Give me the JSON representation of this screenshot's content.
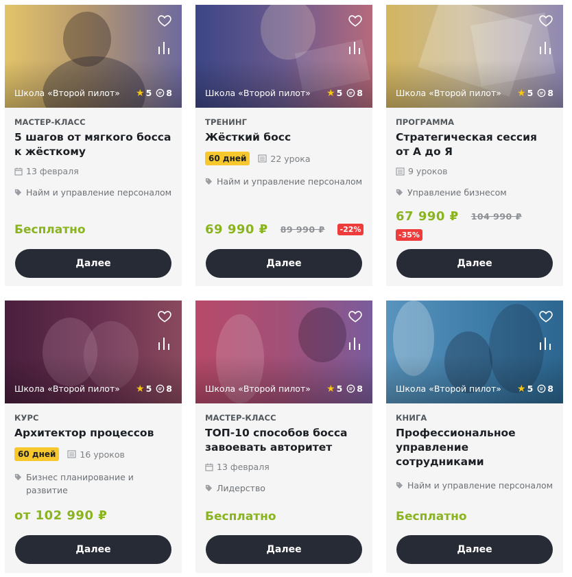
{
  "cards": [
    {
      "school": "Школа «Второй пилот»",
      "rating": "5",
      "comments": "8",
      "type": "МАСТЕР-КЛАСС",
      "title": "5 шагов от мягкого босса к жёсткому",
      "date": "13 февраля",
      "tag": "Найм и управление персоналом",
      "price_free": "Бесплатно",
      "button": "Далее",
      "colors": [
        "#e6c466",
        "#6c6aa0"
      ]
    },
    {
      "school": "Школа «Второй пилот»",
      "rating": "5",
      "comments": "8",
      "type": "ТРЕНИНГ",
      "title": "Жёсткий босс",
      "days_badge": "60 дней",
      "lessons": "22 урока",
      "tag": "Найм и управление персоналом",
      "price": "69 990 ₽",
      "old_price": "89 990 ₽",
      "discount": "-22%",
      "button": "Далее",
      "colors": [
        "#3e4a86",
        "#b4647c"
      ]
    },
    {
      "school": "Школа «Второй пилот»",
      "rating": "5",
      "comments": "8",
      "type": "ПРОГРАММА",
      "title": "Стратегическая сессия от А до Я",
      "lessons": "9 уроков",
      "tag": "Управление бизнесом",
      "price": "67 990 ₽",
      "old_price": "104 990 ₽",
      "discount": "-35%",
      "button": "Далее",
      "colors": [
        "#d9b968",
        "#8c88b0"
      ]
    },
    {
      "school": "Школа «Второй пилот»",
      "rating": "5",
      "comments": "8",
      "type": "КУРС",
      "title": "Архитектор процессов",
      "days_badge": "60 дней",
      "lessons": "16 уроков",
      "tag": "Бизнес планирование и развитие",
      "price": "от 102 990 ₽",
      "button": "Далее",
      "colors": [
        "#5e2a4c",
        "#7a3c58"
      ]
    },
    {
      "school": "Школа «Второй пилот»",
      "rating": "5",
      "comments": "8",
      "type": "МАСТЕР-КЛАСС",
      "title": "ТОП-10 способов босса завоевать авторитет",
      "date": "13 февраля",
      "tag": "Лидерство",
      "price_free": "Бесплатно",
      "button": "Далее",
      "colors": [
        "#b44a6c",
        "#7a5aa0"
      ]
    },
    {
      "school": "Школа «Второй пилот»",
      "rating": "5",
      "comments": "8",
      "type": "КНИГА",
      "title": "Профессиональное управление сотрудниками",
      "tag": "Найм и управление персоналом",
      "price_free": "Бесплатно",
      "button": "Далее",
      "colors": [
        "#4a8ab8",
        "#2e6a9a"
      ]
    }
  ]
}
